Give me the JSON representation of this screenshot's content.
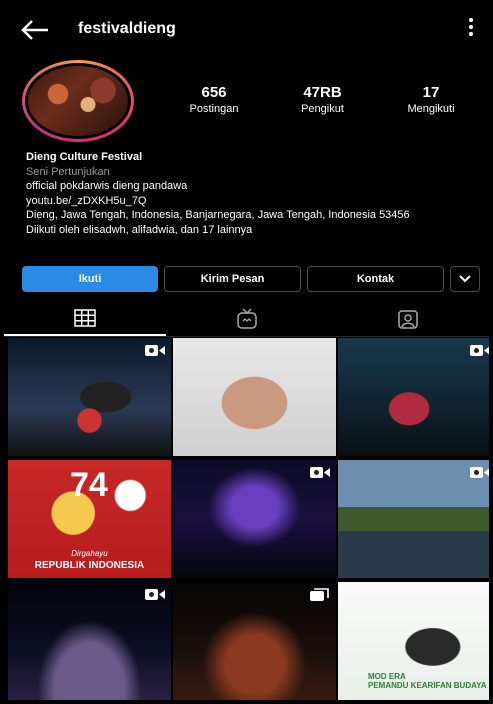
{
  "header": {
    "username": "festivaldieng",
    "back_icon": "arrow-left-icon",
    "more_icon": "more-vertical-icon"
  },
  "profile": {
    "stats": [
      {
        "value": "656",
        "label": "Postingan"
      },
      {
        "value": "47RB",
        "label": "Pengikut"
      },
      {
        "value": "17",
        "label": "Mengikuti"
      }
    ],
    "bio": {
      "name": "Dieng Culture Festival",
      "category": "Seni Pertunjukan",
      "line1": "official pokdarwis dieng pandawa",
      "link": "youtu.be/_zDXKH5u_7Q",
      "address": "Dieng, Jawa Tengah, Indonesia, Banjarnegara, Jawa Tengah, Indonesia 53456",
      "followed_by": "Diikuti oleh elisadwh, alifadwia, dan 17 lainnya"
    }
  },
  "actions": {
    "follow": "Ikuti",
    "message": "Kirim Pesan",
    "contact": "Kontak",
    "dropdown_icon": "chevron-down-icon"
  },
  "tabs": [
    {
      "icon": "grid-icon",
      "active": true
    },
    {
      "icon": "igtv-icon",
      "active": false
    },
    {
      "icon": "tagged-icon",
      "active": false
    }
  ],
  "grid": {
    "cell4_number": "74",
    "cell4_sub": "Dirgahayu",
    "cell4_caption": "REPUBLIK INDONESIA",
    "cell9_mod": "MOD ERA",
    "cell9_text": "PEMANDU KEARIFAN BUDAYA"
  },
  "colors": {
    "accent": "#2b8ae6",
    "background": "#000000"
  }
}
